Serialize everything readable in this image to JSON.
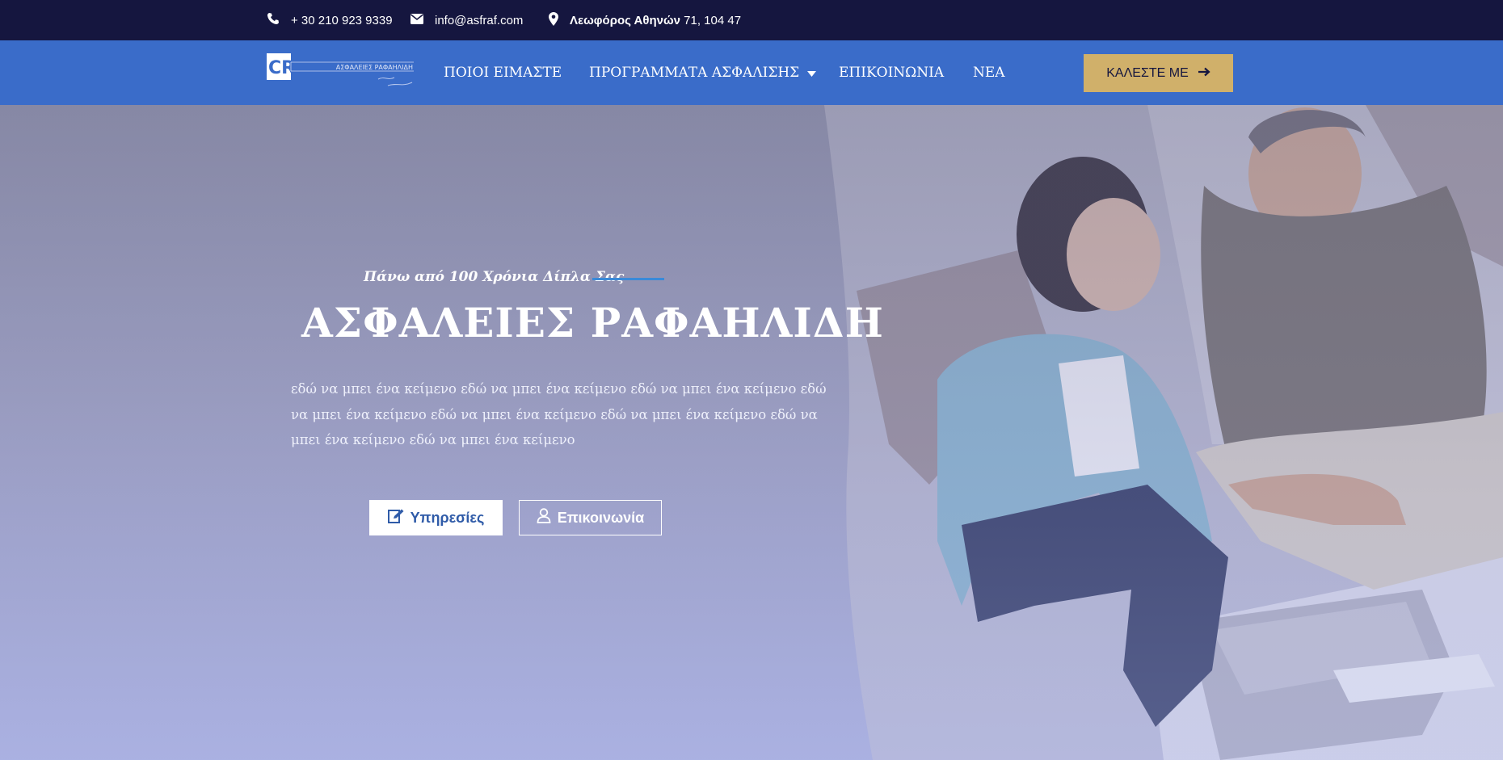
{
  "topbar": {
    "phone": "+ 30 210 923 9339",
    "email": "info@asfraf.com",
    "address_bold": "Λεωφόρος Αθηνών",
    "address_rest": " 71, 104 47"
  },
  "logo": {
    "mark": "CR",
    "name": "ΑΣΦΑΛΕΙΕΣ ΡΑΦΑΗΛΙΔΗ"
  },
  "nav": {
    "items": [
      {
        "label": "ΠΟΙΟΙ ΕΙΜΑΣΤΕ"
      },
      {
        "label": "ΠΡΟΓΡΑΜΜΑΤΑ ΑΣΦΑΛΙΣΗΣ"
      },
      {
        "label": "ΕΠΙΚΟΙΝΩΝΙΑ"
      },
      {
        "label": "ΝΕΑ"
      }
    ],
    "call_button": "ΚΑΛΕΣΤΕ ΜΕ"
  },
  "hero": {
    "tagline": "Πάνω από 100 Χρόνια Δίπλα Σας",
    "headline": "ΑΣΦΑΛΕΙΕΣ ΡΑΦΑΗΛΙΔΗ",
    "lead": "εδώ να μπει ένα κείμενο εδώ να μπει ένα κείμενο εδώ να μπει ένα κείμενο εδώ να μπει ένα κείμενο εδώ να μπει ένα κείμενο εδώ να μπει ένα κείμενο εδώ να μπει ένα κείμενο εδώ να μπει ένα κείμενο",
    "services_button": "Υπηρεσίες",
    "contact_button": "Επικοινωνία"
  },
  "colors": {
    "topbar_bg": "#15163f",
    "nav_bg": "#3a6cc9",
    "call_button_bg": "#d0b06a",
    "accent_line": "#3a8ad8"
  },
  "icons": [
    "phone-icon",
    "envelope-icon",
    "map-pin-icon",
    "caret-down-icon",
    "arrow-right-icon",
    "edit-icon",
    "user-icon"
  ]
}
